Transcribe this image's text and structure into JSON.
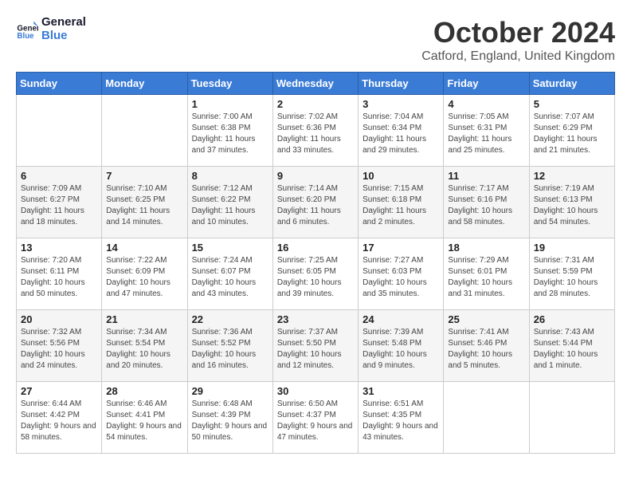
{
  "logo": {
    "line1": "General",
    "line2": "Blue"
  },
  "title": "October 2024",
  "location": "Catford, England, United Kingdom",
  "weekdays": [
    "Sunday",
    "Monday",
    "Tuesday",
    "Wednesday",
    "Thursday",
    "Friday",
    "Saturday"
  ],
  "weeks": [
    [
      {
        "day": "",
        "info": ""
      },
      {
        "day": "",
        "info": ""
      },
      {
        "day": "1",
        "info": "Sunrise: 7:00 AM\nSunset: 6:38 PM\nDaylight: 11 hours and 37 minutes."
      },
      {
        "day": "2",
        "info": "Sunrise: 7:02 AM\nSunset: 6:36 PM\nDaylight: 11 hours and 33 minutes."
      },
      {
        "day": "3",
        "info": "Sunrise: 7:04 AM\nSunset: 6:34 PM\nDaylight: 11 hours and 29 minutes."
      },
      {
        "day": "4",
        "info": "Sunrise: 7:05 AM\nSunset: 6:31 PM\nDaylight: 11 hours and 25 minutes."
      },
      {
        "day": "5",
        "info": "Sunrise: 7:07 AM\nSunset: 6:29 PM\nDaylight: 11 hours and 21 minutes."
      }
    ],
    [
      {
        "day": "6",
        "info": "Sunrise: 7:09 AM\nSunset: 6:27 PM\nDaylight: 11 hours and 18 minutes."
      },
      {
        "day": "7",
        "info": "Sunrise: 7:10 AM\nSunset: 6:25 PM\nDaylight: 11 hours and 14 minutes."
      },
      {
        "day": "8",
        "info": "Sunrise: 7:12 AM\nSunset: 6:22 PM\nDaylight: 11 hours and 10 minutes."
      },
      {
        "day": "9",
        "info": "Sunrise: 7:14 AM\nSunset: 6:20 PM\nDaylight: 11 hours and 6 minutes."
      },
      {
        "day": "10",
        "info": "Sunrise: 7:15 AM\nSunset: 6:18 PM\nDaylight: 11 hours and 2 minutes."
      },
      {
        "day": "11",
        "info": "Sunrise: 7:17 AM\nSunset: 6:16 PM\nDaylight: 10 hours and 58 minutes."
      },
      {
        "day": "12",
        "info": "Sunrise: 7:19 AM\nSunset: 6:13 PM\nDaylight: 10 hours and 54 minutes."
      }
    ],
    [
      {
        "day": "13",
        "info": "Sunrise: 7:20 AM\nSunset: 6:11 PM\nDaylight: 10 hours and 50 minutes."
      },
      {
        "day": "14",
        "info": "Sunrise: 7:22 AM\nSunset: 6:09 PM\nDaylight: 10 hours and 47 minutes."
      },
      {
        "day": "15",
        "info": "Sunrise: 7:24 AM\nSunset: 6:07 PM\nDaylight: 10 hours and 43 minutes."
      },
      {
        "day": "16",
        "info": "Sunrise: 7:25 AM\nSunset: 6:05 PM\nDaylight: 10 hours and 39 minutes."
      },
      {
        "day": "17",
        "info": "Sunrise: 7:27 AM\nSunset: 6:03 PM\nDaylight: 10 hours and 35 minutes."
      },
      {
        "day": "18",
        "info": "Sunrise: 7:29 AM\nSunset: 6:01 PM\nDaylight: 10 hours and 31 minutes."
      },
      {
        "day": "19",
        "info": "Sunrise: 7:31 AM\nSunset: 5:59 PM\nDaylight: 10 hours and 28 minutes."
      }
    ],
    [
      {
        "day": "20",
        "info": "Sunrise: 7:32 AM\nSunset: 5:56 PM\nDaylight: 10 hours and 24 minutes."
      },
      {
        "day": "21",
        "info": "Sunrise: 7:34 AM\nSunset: 5:54 PM\nDaylight: 10 hours and 20 minutes."
      },
      {
        "day": "22",
        "info": "Sunrise: 7:36 AM\nSunset: 5:52 PM\nDaylight: 10 hours and 16 minutes."
      },
      {
        "day": "23",
        "info": "Sunrise: 7:37 AM\nSunset: 5:50 PM\nDaylight: 10 hours and 12 minutes."
      },
      {
        "day": "24",
        "info": "Sunrise: 7:39 AM\nSunset: 5:48 PM\nDaylight: 10 hours and 9 minutes."
      },
      {
        "day": "25",
        "info": "Sunrise: 7:41 AM\nSunset: 5:46 PM\nDaylight: 10 hours and 5 minutes."
      },
      {
        "day": "26",
        "info": "Sunrise: 7:43 AM\nSunset: 5:44 PM\nDaylight: 10 hours and 1 minute."
      }
    ],
    [
      {
        "day": "27",
        "info": "Sunrise: 6:44 AM\nSunset: 4:42 PM\nDaylight: 9 hours and 58 minutes."
      },
      {
        "day": "28",
        "info": "Sunrise: 6:46 AM\nSunset: 4:41 PM\nDaylight: 9 hours and 54 minutes."
      },
      {
        "day": "29",
        "info": "Sunrise: 6:48 AM\nSunset: 4:39 PM\nDaylight: 9 hours and 50 minutes."
      },
      {
        "day": "30",
        "info": "Sunrise: 6:50 AM\nSunset: 4:37 PM\nDaylight: 9 hours and 47 minutes."
      },
      {
        "day": "31",
        "info": "Sunrise: 6:51 AM\nSunset: 4:35 PM\nDaylight: 9 hours and 43 minutes."
      },
      {
        "day": "",
        "info": ""
      },
      {
        "day": "",
        "info": ""
      }
    ]
  ]
}
